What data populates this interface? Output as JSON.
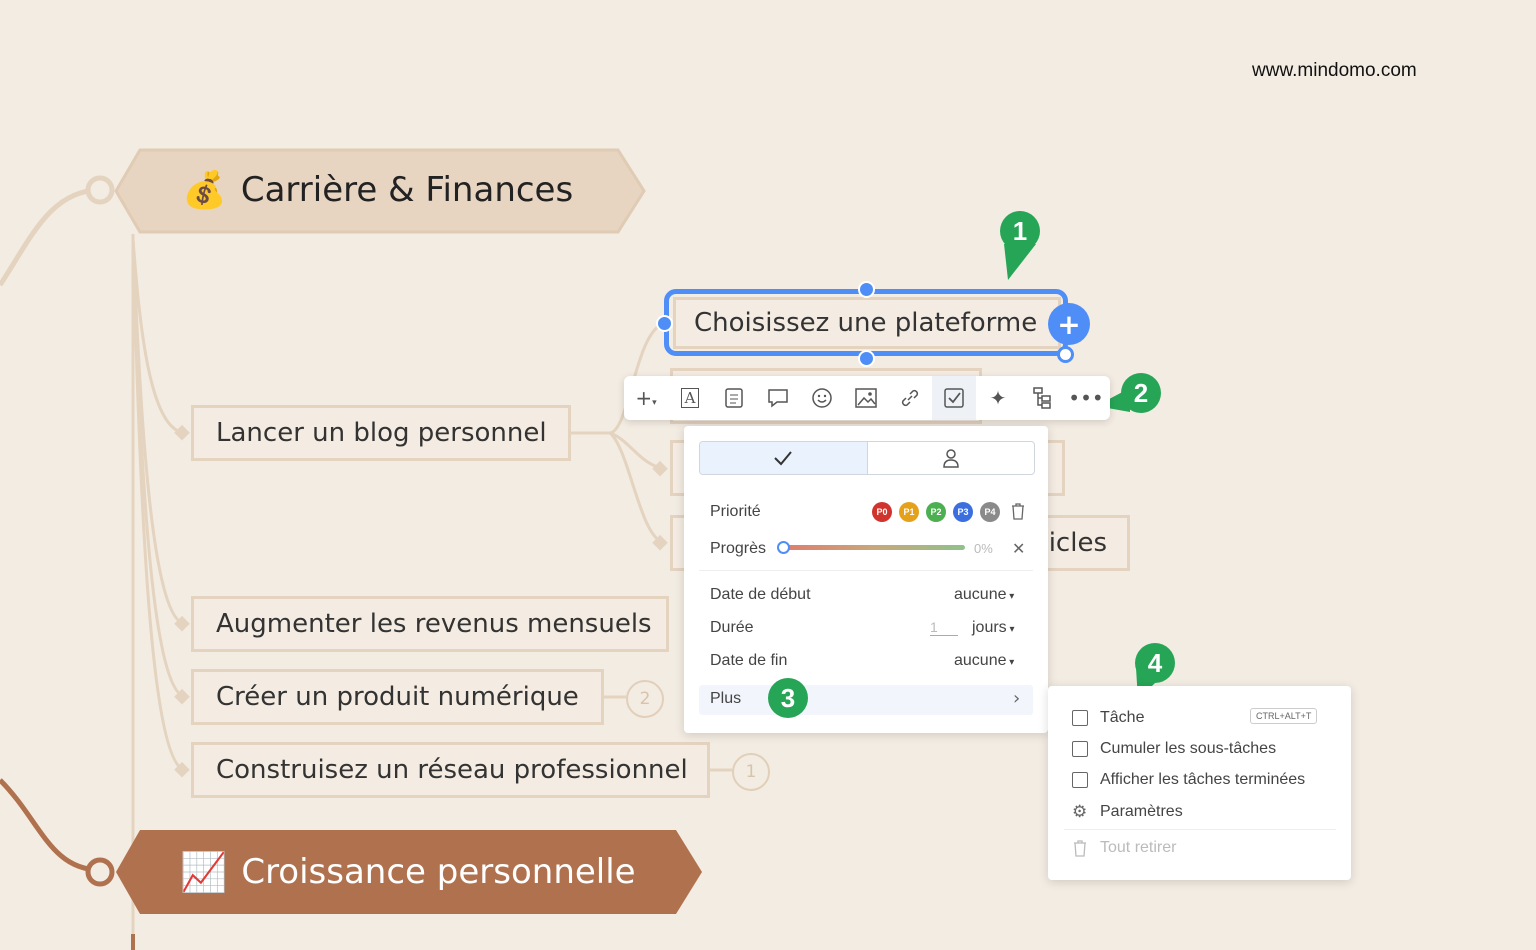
{
  "site_url": "www.mindomo.com",
  "main_topics": {
    "career": {
      "icon": "money-bag-icon",
      "emoji": "💰",
      "label": "Carrière & Finances"
    },
    "growth": {
      "icon": "chart-icon",
      "emoji": "📈",
      "label": "Croissance personnelle"
    }
  },
  "nodes": {
    "blog": "Lancer un blog personnel",
    "revenue": "Augmenter les revenus mensuels",
    "product": "Créer un produit numérique",
    "network": "Construisez un réseau professionnel",
    "selected": "Choisissez une plateforme",
    "articles_partial": "icles"
  },
  "counters": {
    "product": "2",
    "network": "1"
  },
  "toolbar": {
    "items": [
      "add-icon",
      "text-style-icon",
      "notes-icon",
      "comment-icon",
      "emoji-icon",
      "image-icon",
      "link-icon",
      "task-icon",
      "ai-sparkle-icon",
      "structure-icon",
      "more-icon"
    ],
    "active": "task-icon"
  },
  "task_panel": {
    "priority_label": "Priorité",
    "priorities": [
      {
        "label": "P0",
        "color": "#d0342c"
      },
      {
        "label": "P1",
        "color": "#e5a11a"
      },
      {
        "label": "P2",
        "color": "#4caf50"
      },
      {
        "label": "P3",
        "color": "#3b6fe0"
      },
      {
        "label": "P4",
        "color": "#8a8a8a"
      }
    ],
    "progress_label": "Progrès",
    "progress_value": "0%",
    "start_label": "Date de début",
    "start_value": "aucune",
    "duration_label": "Durée",
    "duration_value": "1",
    "duration_unit": "jours",
    "end_label": "Date de fin",
    "end_value": "aucune",
    "more_label": "Plus"
  },
  "more_menu": {
    "task": "Tâche",
    "task_shortcut": "CTRL+ALT+T",
    "cumulate": "Cumuler les sous-tâches",
    "show_done": "Afficher les tâches terminées",
    "settings": "Paramètres",
    "remove_all": "Tout retirer"
  },
  "badges": [
    "1",
    "2",
    "3",
    "4"
  ],
  "colors": {
    "selection": "#4f8ef7",
    "badge": "#27a556",
    "growth_topic": "#b0714f",
    "career_topic": "#e8d5c1"
  }
}
